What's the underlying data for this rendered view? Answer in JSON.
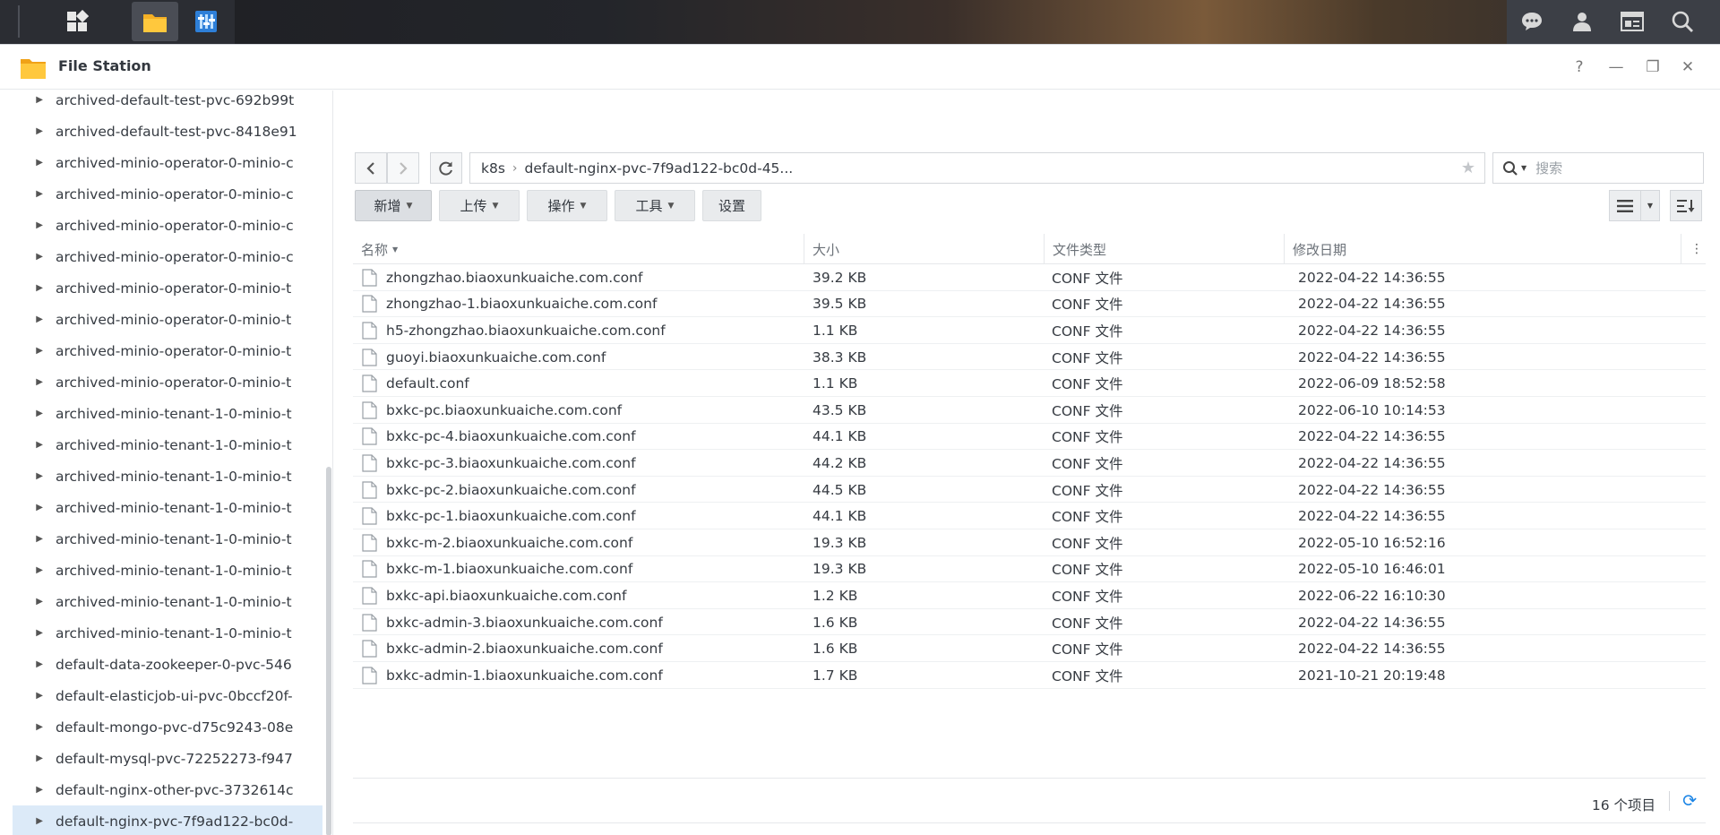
{
  "app": {
    "title": "File Station"
  },
  "window_controls": {
    "help": "?",
    "minimize": "—",
    "restore": "❐",
    "close": "✕"
  },
  "sidebar": {
    "items": [
      {
        "label": "archived-default-test-pvc-692b99t",
        "selected": false
      },
      {
        "label": "archived-default-test-pvc-8418e91",
        "selected": false
      },
      {
        "label": "archived-minio-operator-0-minio-c",
        "selected": false
      },
      {
        "label": "archived-minio-operator-0-minio-c",
        "selected": false
      },
      {
        "label": "archived-minio-operator-0-minio-c",
        "selected": false
      },
      {
        "label": "archived-minio-operator-0-minio-c",
        "selected": false
      },
      {
        "label": "archived-minio-operator-0-minio-t",
        "selected": false
      },
      {
        "label": "archived-minio-operator-0-minio-t",
        "selected": false
      },
      {
        "label": "archived-minio-operator-0-minio-t",
        "selected": false
      },
      {
        "label": "archived-minio-operator-0-minio-t",
        "selected": false
      },
      {
        "label": "archived-minio-tenant-1-0-minio-t",
        "selected": false
      },
      {
        "label": "archived-minio-tenant-1-0-minio-t",
        "selected": false
      },
      {
        "label": "archived-minio-tenant-1-0-minio-t",
        "selected": false
      },
      {
        "label": "archived-minio-tenant-1-0-minio-t",
        "selected": false
      },
      {
        "label": "archived-minio-tenant-1-0-minio-t",
        "selected": false
      },
      {
        "label": "archived-minio-tenant-1-0-minio-t",
        "selected": false
      },
      {
        "label": "archived-minio-tenant-1-0-minio-t",
        "selected": false
      },
      {
        "label": "archived-minio-tenant-1-0-minio-t",
        "selected": false
      },
      {
        "label": "default-data-zookeeper-0-pvc-546",
        "selected": false
      },
      {
        "label": "default-elasticjob-ui-pvc-0bccf20f-",
        "selected": false
      },
      {
        "label": "default-mongo-pvc-d75c9243-08e",
        "selected": false
      },
      {
        "label": "default-mysql-pvc-72252273-f947",
        "selected": false
      },
      {
        "label": "default-nginx-other-pvc-3732614c",
        "selected": false
      },
      {
        "label": "default-nginx-pvc-7f9ad122-bc0d-",
        "selected": true
      }
    ]
  },
  "path": {
    "root": "k8s",
    "current": "default-nginx-pvc-7f9ad122-bc0d-45..."
  },
  "search": {
    "placeholder": "搜索"
  },
  "toolbar": {
    "create": "新增",
    "upload": "上传",
    "action": "操作",
    "tools": "工具",
    "settings": "设置"
  },
  "table": {
    "columns": {
      "name": "名称",
      "size": "大小",
      "type": "文件类型",
      "modified": "修改日期"
    },
    "rows": [
      {
        "name": "zhongzhao.biaoxunkuaiche.com.conf",
        "size": "39.2 KB",
        "type": "CONF 文件",
        "modified": "2022-04-22 14:36:55"
      },
      {
        "name": "zhongzhao-1.biaoxunkuaiche.com.conf",
        "size": "39.5 KB",
        "type": "CONF 文件",
        "modified": "2022-04-22 14:36:55"
      },
      {
        "name": "h5-zhongzhao.biaoxunkuaiche.com.conf",
        "size": "1.1 KB",
        "type": "CONF 文件",
        "modified": "2022-04-22 14:36:55"
      },
      {
        "name": "guoyi.biaoxunkuaiche.com.conf",
        "size": "38.3 KB",
        "type": "CONF 文件",
        "modified": "2022-04-22 14:36:55"
      },
      {
        "name": "default.conf",
        "size": "1.1 KB",
        "type": "CONF 文件",
        "modified": "2022-06-09 18:52:58"
      },
      {
        "name": "bxkc-pc.biaoxunkuaiche.com.conf",
        "size": "43.5 KB",
        "type": "CONF 文件",
        "modified": "2022-06-10 10:14:53"
      },
      {
        "name": "bxkc-pc-4.biaoxunkuaiche.com.conf",
        "size": "44.1 KB",
        "type": "CONF 文件",
        "modified": "2022-04-22 14:36:55"
      },
      {
        "name": "bxkc-pc-3.biaoxunkuaiche.com.conf",
        "size": "44.2 KB",
        "type": "CONF 文件",
        "modified": "2022-04-22 14:36:55"
      },
      {
        "name": "bxkc-pc-2.biaoxunkuaiche.com.conf",
        "size": "44.5 KB",
        "type": "CONF 文件",
        "modified": "2022-04-22 14:36:55"
      },
      {
        "name": "bxkc-pc-1.biaoxunkuaiche.com.conf",
        "size": "44.1 KB",
        "type": "CONF 文件",
        "modified": "2022-04-22 14:36:55"
      },
      {
        "name": "bxkc-m-2.biaoxunkuaiche.com.conf",
        "size": "19.3 KB",
        "type": "CONF 文件",
        "modified": "2022-05-10 16:52:16"
      },
      {
        "name": "bxkc-m-1.biaoxunkuaiche.com.conf",
        "size": "19.3 KB",
        "type": "CONF 文件",
        "modified": "2022-05-10 16:46:01"
      },
      {
        "name": "bxkc-api.biaoxunkuaiche.com.conf",
        "size": "1.2 KB",
        "type": "CONF 文件",
        "modified": "2022-06-22 16:10:30"
      },
      {
        "name": "bxkc-admin-3.biaoxunkuaiche.com.conf",
        "size": "1.6 KB",
        "type": "CONF 文件",
        "modified": "2022-04-22 14:36:55"
      },
      {
        "name": "bxkc-admin-2.biaoxunkuaiche.com.conf",
        "size": "1.6 KB",
        "type": "CONF 文件",
        "modified": "2022-04-22 14:36:55"
      },
      {
        "name": "bxkc-admin-1.biaoxunkuaiche.com.conf",
        "size": "1.7 KB",
        "type": "CONF 文件",
        "modified": "2021-10-21 20:19:48"
      }
    ]
  },
  "footer": {
    "count": "16 个项目"
  },
  "colors": {
    "accent": "#1a84e5",
    "selected_row": "#dceaf8",
    "folder": "#f5b025"
  }
}
